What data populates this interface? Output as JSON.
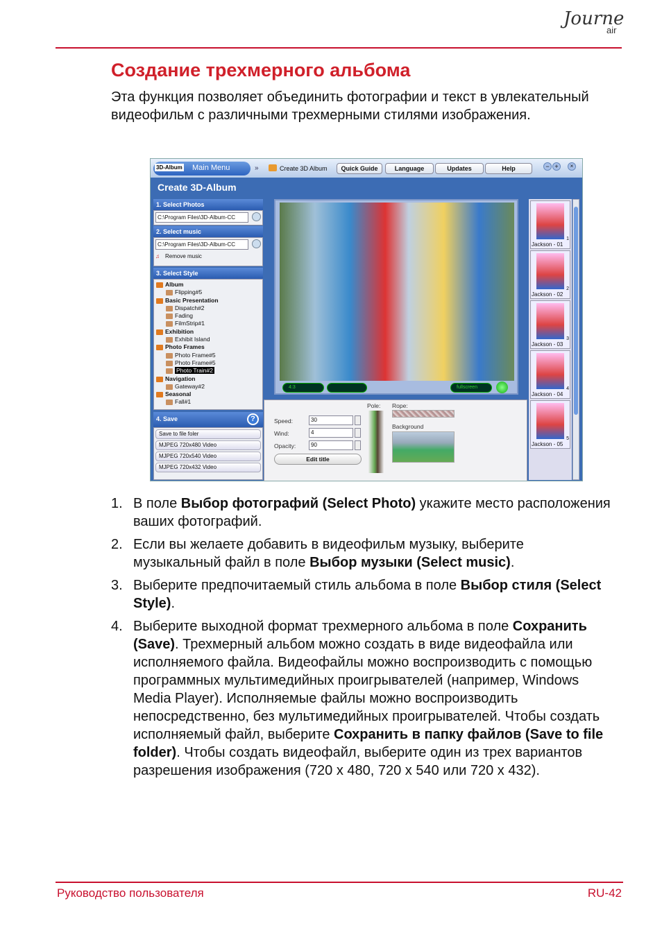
{
  "header": {
    "logo_text": "Journe",
    "logo_suffix": "air"
  },
  "title": "Создание трехмерного альбома",
  "intro": "Эта функция позволяет объединить фотографии и текст в увлекательный видеофильм с различными трехмерными стилями изображения.",
  "app": {
    "logo": "3D-Album",
    "main_menu": "Main Menu",
    "breadcrumb": "Create 3D Album",
    "tabs": [
      "Quick Guide",
      "Language",
      "Updates",
      "Help"
    ],
    "window_title": "Create 3D-Album",
    "section1": {
      "title": "1. Select Photos",
      "path": "C:\\Program Files\\3D-Album-CC"
    },
    "section2": {
      "title": "2. Select music",
      "path": "C:\\Program Files\\3D-Album-CC",
      "remove": "Remove music"
    },
    "section3": {
      "title": "3. Select Style",
      "tree": [
        {
          "type": "g",
          "label": "Album"
        },
        {
          "type": "i",
          "label": "Flipping#5"
        },
        {
          "type": "g",
          "label": "Basic Presentation"
        },
        {
          "type": "i",
          "label": "Dispatch#2"
        },
        {
          "type": "i",
          "label": "Fading"
        },
        {
          "type": "i",
          "label": "FilmStrip#1"
        },
        {
          "type": "g",
          "label": "Exhibition"
        },
        {
          "type": "i",
          "label": "Exhibit Island"
        },
        {
          "type": "g",
          "label": "Photo Frames"
        },
        {
          "type": "i",
          "label": "Photo Frame#5"
        },
        {
          "type": "i",
          "label": "Photo Frame#5"
        },
        {
          "type": "i",
          "label": "Photo Train#2",
          "selected": true
        },
        {
          "type": "g",
          "label": "Navigation"
        },
        {
          "type": "i",
          "label": "Gateway#2"
        },
        {
          "type": "g",
          "label": "Seasonal"
        },
        {
          "type": "i",
          "label": "Fall#1"
        }
      ]
    },
    "section4": {
      "title": "4. Save",
      "options": [
        "Save to file foler",
        "MJPEG 720x480 Video",
        "MJPEG 720x540 Video",
        "MJPEG 720x432 Video"
      ]
    },
    "preview": {
      "aspect": "4:3",
      "fullscreen": "fullscreen"
    },
    "settings": {
      "speed_label": "Speed:",
      "speed": "30",
      "wind_label": "Wind:",
      "wind": "4",
      "opacity_label": "Opacity:",
      "opacity": "90",
      "edit_title": "Edit title",
      "pole": "Pole:",
      "rope": "Rope:",
      "background": "Background"
    },
    "thumbnails": [
      {
        "label": "Jackson - 01",
        "n": "1"
      },
      {
        "label": "Jackson - 02",
        "n": "2"
      },
      {
        "label": "Jackson - 03",
        "n": "3"
      },
      {
        "label": "Jackson - 04",
        "n": "4"
      },
      {
        "label": "Jackson - 05",
        "n": "5"
      }
    ]
  },
  "steps": [
    {
      "n": "1.",
      "parts": [
        {
          "t": "В поле "
        },
        {
          "t": "Выбор фотографий (Select Photo)",
          "b": true
        },
        {
          "t": " укажите место расположения ваших фотографий."
        }
      ]
    },
    {
      "n": "2.",
      "parts": [
        {
          "t": "Если вы желаете добавить в видеофильм музыку, выберите музыкальный файл в поле "
        },
        {
          "t": "Выбор музыки (Select music)",
          "b": true
        },
        {
          "t": "."
        }
      ]
    },
    {
      "n": "3.",
      "parts": [
        {
          "t": "Выберите предпочитаемый стиль альбома в поле "
        },
        {
          "t": "Выбор стиля (Select Style)",
          "b": true
        },
        {
          "t": "."
        }
      ]
    },
    {
      "n": "4.",
      "parts": [
        {
          "t": "Выберите выходной формат трехмерного альбома в поле "
        },
        {
          "t": "Сохранить (Save)",
          "b": true
        },
        {
          "t": ". Трехмерный альбом можно создать в виде видеофайла или исполняемого файла. Видеофайлы можно воспроизводить с помощью программных мультимедийных проигрывателей (например, Windows Media Player). Исполняемые файлы можно воспроизводить непосредственно, без мультимедийных проигрывателей. Чтобы создать исполняемый файл, выберите "
        },
        {
          "t": "Сохранить в папку файлов (Save to file folder)",
          "b": true
        },
        {
          "t": ". Чтобы создать видеофайл, выберите один из трех вариантов разрешения изображения (720 x 480, 720 x 540 или 720 x 432)."
        }
      ]
    }
  ],
  "footer": {
    "left": "Руководство пользователя",
    "right": "RU-42"
  },
  "colors": {
    "accent": "#c8102e",
    "app_blue": "#3c6cb4"
  }
}
